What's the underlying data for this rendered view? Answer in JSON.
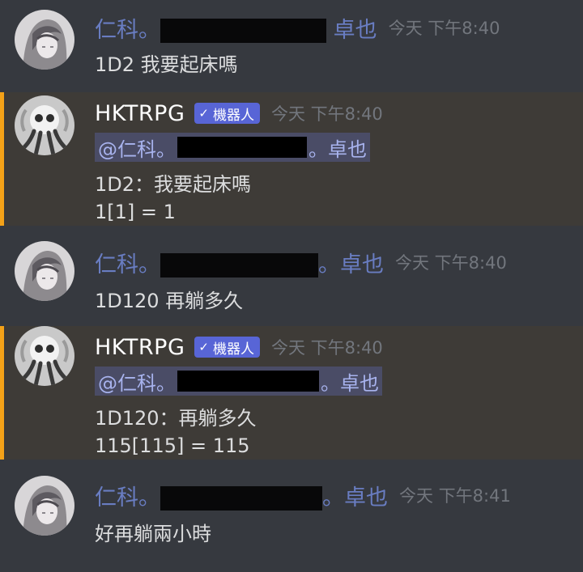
{
  "messages": [
    {
      "type": "user",
      "username_prefix": "仁科。",
      "username_suffix": "卓也",
      "timestamp": "今天 下午8:40",
      "lines": [
        "1D2 我要起床嗎"
      ]
    },
    {
      "type": "bot",
      "username": "HKTRPG",
      "badge": "機器人",
      "badge_icon": "checkmark-icon",
      "timestamp": "今天 下午8:40",
      "mention_prefix": "@仁科。",
      "mention_suffix": "。卓也",
      "lines": [
        "1D2：我要起床嗎",
        "1[1] = 1"
      ]
    },
    {
      "type": "user",
      "username_prefix": "仁科。",
      "username_suffix": "。卓也",
      "timestamp": "今天 下午8:40",
      "lines": [
        "1D120 再躺多久"
      ]
    },
    {
      "type": "bot",
      "username": "HKTRPG",
      "badge": "機器人",
      "badge_icon": "checkmark-icon",
      "timestamp": "今天 下午8:40",
      "mention_prefix": "@仁科。",
      "mention_suffix": "。卓也",
      "lines": [
        "1D120：再躺多久",
        "115[115] = 115"
      ]
    },
    {
      "type": "user",
      "username_prefix": "仁科。",
      "username_suffix": "。卓也",
      "timestamp": "今天 下午8:41",
      "lines": [
        "好再躺兩小時"
      ]
    }
  ],
  "colors": {
    "background": "#36393f",
    "bot_background": "#3e3b37",
    "bot_accent": "#f4a218",
    "username": "#7289da",
    "badge": "#5865d6",
    "mention_background": "#4a4c66",
    "text": "#dcddde",
    "timestamp": "#72767d"
  }
}
